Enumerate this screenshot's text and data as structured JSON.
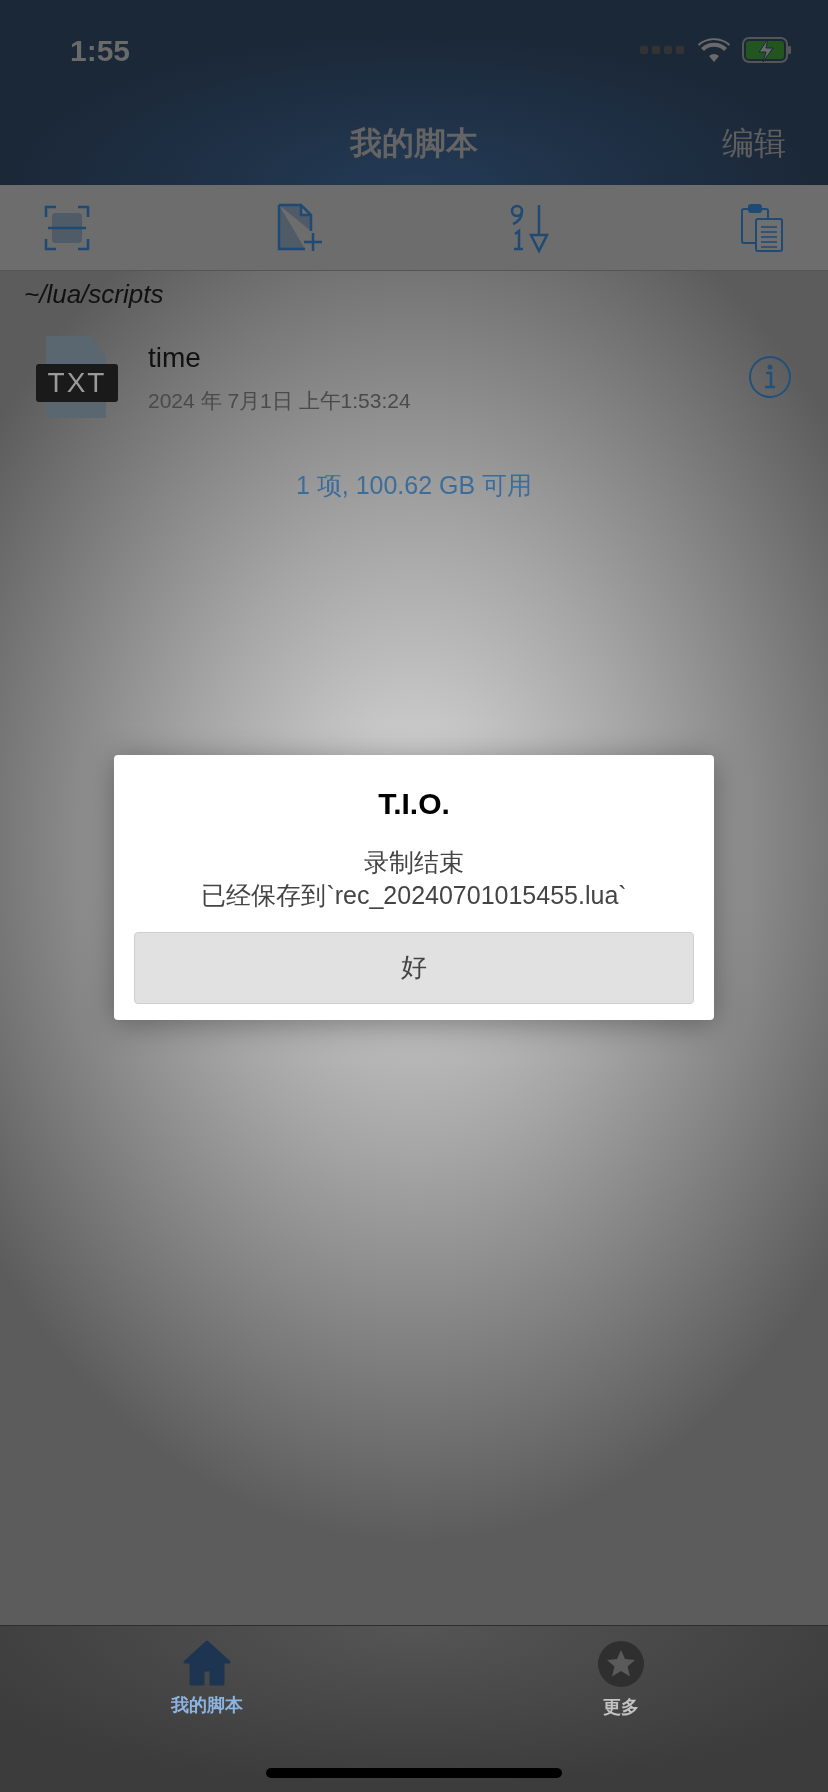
{
  "status_bar": {
    "time": "1:55",
    "charging": true
  },
  "nav": {
    "title": "我的脚本",
    "edit_button": "编辑"
  },
  "toolbar": {
    "items": [
      {
        "kind": "scan"
      },
      {
        "kind": "new-file"
      },
      {
        "kind": "sort"
      },
      {
        "kind": "paste"
      }
    ]
  },
  "path": "~/lua/scripts",
  "files": [
    {
      "name": "time",
      "type_badge": "TXT",
      "date": "2024 年 7月1日 上午1:53:24"
    }
  ],
  "summary": "1 项, 100.62 GB 可用",
  "dialog": {
    "title": "T.I.O.",
    "message": [
      "录制结束",
      "已经保存到`rec_20240701015455.lua`"
    ],
    "buttons": [
      "好"
    ]
  },
  "tabs": [
    {
      "label": "我的脚本",
      "kind": "home",
      "selected": true
    },
    {
      "label": "更多",
      "kind": "star",
      "selected": false
    }
  ]
}
